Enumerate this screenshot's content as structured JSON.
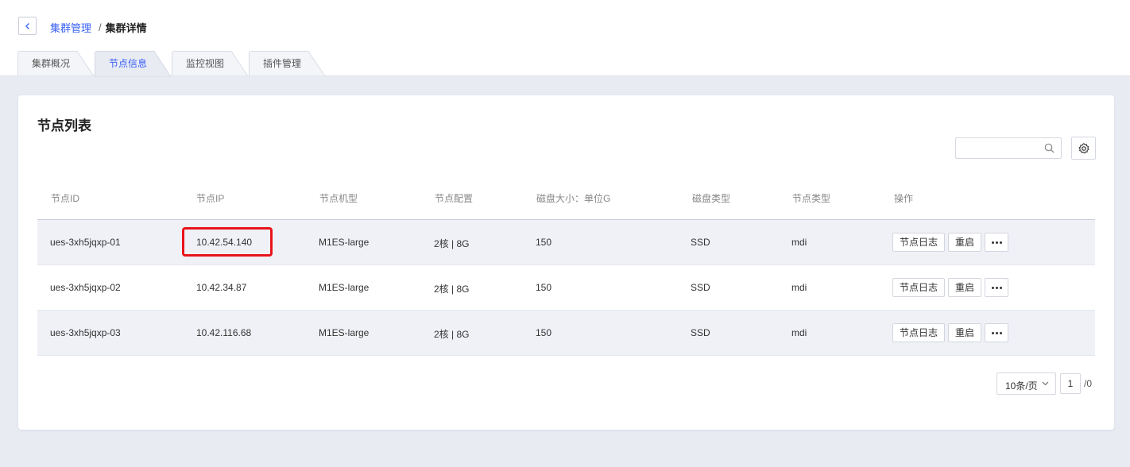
{
  "breadcrumb": {
    "parent": "集群管理",
    "separator": "/",
    "current": "集群详情"
  },
  "tabs": [
    {
      "label": "集群概况",
      "active": false
    },
    {
      "label": "节点信息",
      "active": true
    },
    {
      "label": "监控视图",
      "active": false
    },
    {
      "label": "插件管理",
      "active": false
    }
  ],
  "card": {
    "title": "节点列表",
    "search_placeholder": ""
  },
  "table": {
    "columns": [
      "节点ID",
      "节点IP",
      "节点机型",
      "节点配置",
      "磁盘大小：单位G",
      "磁盘类型",
      "节点类型",
      "操作"
    ],
    "rows": [
      {
        "id": "ues-3xh5jqxp-01",
        "ip": "10.42.54.140",
        "model": "M1ES-large",
        "config": "2核 | 8G",
        "disk_size": "150",
        "disk_type": "SSD",
        "node_type": "mdi"
      },
      {
        "id": "ues-3xh5jqxp-02",
        "ip": "10.42.34.87",
        "model": "M1ES-large",
        "config": "2核 | 8G",
        "disk_size": "150",
        "disk_type": "SSD",
        "node_type": "mdi"
      },
      {
        "id": "ues-3xh5jqxp-03",
        "ip": "10.42.116.68",
        "model": "M1ES-large",
        "config": "2核 | 8G",
        "disk_size": "150",
        "disk_type": "SSD",
        "node_type": "mdi"
      }
    ],
    "actions": {
      "log": "节点日志",
      "restart": "重启"
    }
  },
  "pagination": {
    "page_size": "10条/页",
    "current_page": "1",
    "total": "/0"
  },
  "colors": {
    "accent": "#3860f4",
    "highlight": "#e8141a",
    "page_bg": "#e9ebf3",
    "row_shade": "#eff1f7"
  },
  "icons": {
    "back": "chevron-left-icon",
    "search": "search-icon",
    "settings": "gear-icon",
    "page_size": "chevron-down-icon",
    "more": "more-dots-icon"
  }
}
